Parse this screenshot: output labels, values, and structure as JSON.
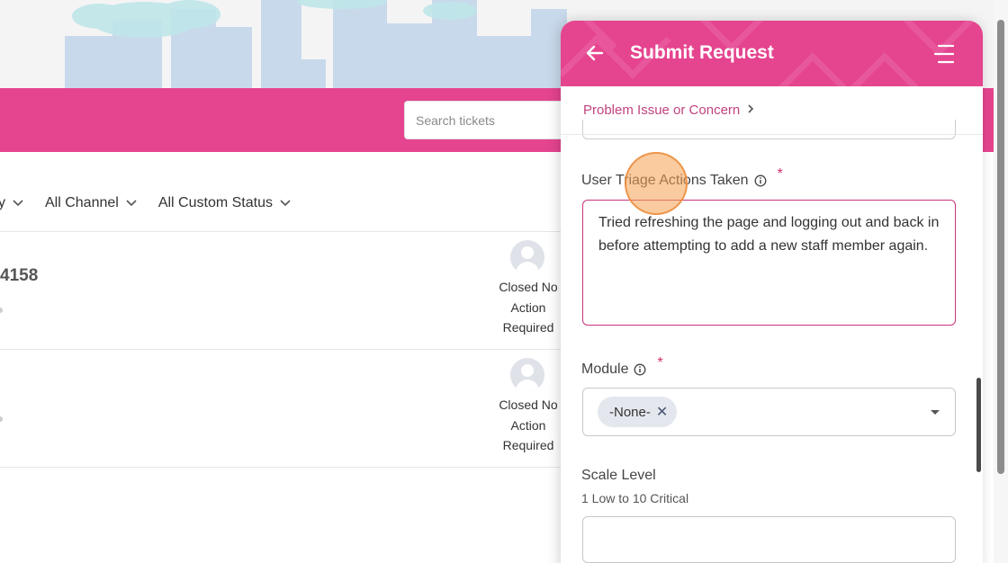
{
  "header": {
    "search": {
      "placeholder": "Search tickets"
    }
  },
  "filters": [
    {
      "label": "y"
    },
    {
      "label": "All Channel"
    },
    {
      "label": "All Custom Status"
    }
  ],
  "tickets": [
    {
      "id_partial": "4158",
      "status_lines": [
        "Closed No",
        "Action",
        "Required"
      ]
    },
    {
      "id_partial": "",
      "status_lines": [
        "Closed No",
        "Action",
        "Required"
      ]
    }
  ],
  "panel": {
    "title": "Submit Request",
    "breadcrumb": "Problem Issue or Concern",
    "fields": {
      "triage": {
        "label": "User Triage Actions Taken",
        "required_mark": "*",
        "value": "Tried refreshing the page and logging out and back in before attempting to add a new staff member again."
      },
      "module": {
        "label": "Module",
        "required_mark": "*",
        "chip": "-None-"
      },
      "scale": {
        "label": "Scale Level",
        "hint": "1 Low to 10 Critical",
        "value": ""
      }
    }
  },
  "icons": {
    "back": "arrow-left-icon",
    "menu": "menu-icon",
    "info": "info-icon",
    "chevron": "chevron-down-icon",
    "remove": "close-icon"
  },
  "colors": {
    "brand_pink": "#e5448f",
    "link_pink": "#c2427f",
    "required": "#d0306e"
  }
}
